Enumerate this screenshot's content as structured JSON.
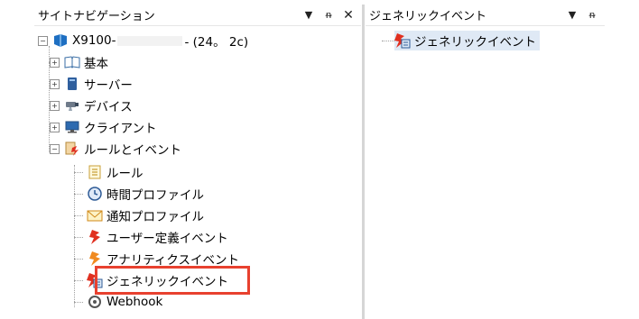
{
  "left_pane": {
    "title": "サイトナビゲーション",
    "pin": "▾ ᵰ",
    "close": "✕",
    "root": {
      "prefix": "X9100-",
      "suffix": "- (24。 2c)"
    },
    "items": [
      {
        "label": "基本",
        "icon": "book-icon"
      },
      {
        "label": "サーバー",
        "icon": "server-icon"
      },
      {
        "label": "デバイス",
        "icon": "camera-icon"
      },
      {
        "label": "クライアント",
        "icon": "monitor-icon"
      },
      {
        "label": "ルールとイベント",
        "icon": "rules-events-icon"
      }
    ],
    "children": [
      {
        "label": "ルール",
        "icon": "rule-list-icon"
      },
      {
        "label": "時間プロファイル",
        "icon": "clock-icon"
      },
      {
        "label": "通知プロファイル",
        "icon": "envelope-icon"
      },
      {
        "label": "ユーザー定義イベント",
        "icon": "user-event-icon"
      },
      {
        "label": "アナリティクスイベント",
        "icon": "analytics-event-icon"
      },
      {
        "label": "ジェネリックイベント",
        "icon": "generic-event-icon"
      },
      {
        "label": "Webhook",
        "icon": "webhook-icon"
      }
    ]
  },
  "right_pane": {
    "title": "ジェネリックイベント",
    "pin": "▾ ᵰ",
    "item": {
      "label": "ジェネリックイベント",
      "icon": "generic-event-icon"
    }
  },
  "colors": {
    "highlight": "#e8412f",
    "event_red": "#e03020"
  }
}
